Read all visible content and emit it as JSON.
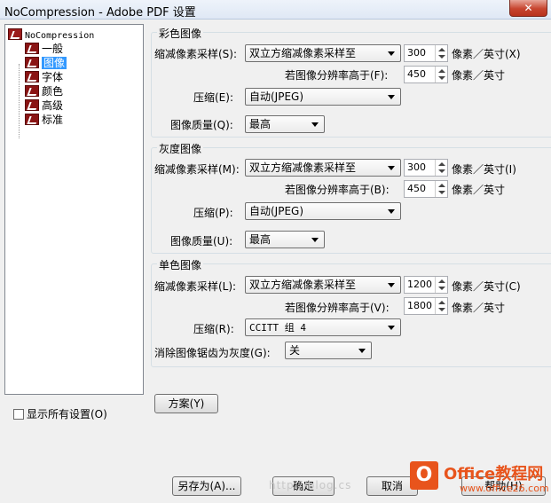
{
  "window": {
    "title": "NoCompression - Adobe PDF 设置",
    "close_label": "✕"
  },
  "tree": {
    "root": "NoCompression",
    "items": [
      {
        "label": "一般"
      },
      {
        "label": "图像",
        "selected": true
      },
      {
        "label": "字体"
      },
      {
        "label": "颜色"
      },
      {
        "label": "高级"
      },
      {
        "label": "标准"
      }
    ]
  },
  "show_all_settings": {
    "label": "显示所有设置(O)",
    "checked": false
  },
  "color_images": {
    "title": "彩色图像",
    "downsample_label": "缩减像素采样(S):",
    "downsample_value": "双立方缩减像素采样至",
    "ppi_value": "300",
    "ppi_unit": "像素／英寸(X)",
    "above_label": "若图像分辨率高于(F):",
    "above_value": "450",
    "above_unit": "像素／英寸",
    "compression_label": "压缩(E):",
    "compression_value": "自动(JPEG)",
    "quality_label": "图像质量(Q):",
    "quality_value": "最高"
  },
  "gray_images": {
    "title": "灰度图像",
    "downsample_label": "缩减像素采样(M):",
    "downsample_value": "双立方缩减像素采样至",
    "ppi_value": "300",
    "ppi_unit": "像素／英寸(I)",
    "above_label": "若图像分辨率高于(B):",
    "above_value": "450",
    "above_unit": "像素／英寸",
    "compression_label": "压缩(P):",
    "compression_value": "自动(JPEG)",
    "quality_label": "图像质量(U):",
    "quality_value": "最高"
  },
  "mono_images": {
    "title": "单色图像",
    "downsample_label": "缩减像素采样(L):",
    "downsample_value": "双立方缩减像素采样至",
    "ppi_value": "1200",
    "ppi_unit": "像素／英寸(C)",
    "above_label": "若图像分辨率高于(V):",
    "above_value": "1800",
    "above_unit": "像素／英寸",
    "compression_label": "压缩(R):",
    "compression_value": "CCITT 组 4",
    "antialias_label": "消除图像锯齿为灰度(G):",
    "antialias_value": "关"
  },
  "buttons": {
    "policy": "方案(Y)",
    "save_as": "另存为(A)...",
    "ok": "确定",
    "cancel": "取消",
    "help": "帮助(H)"
  },
  "watermark": {
    "url": "http://blog.cs",
    "brand": "Office教程网",
    "site": "www.office26.com"
  }
}
